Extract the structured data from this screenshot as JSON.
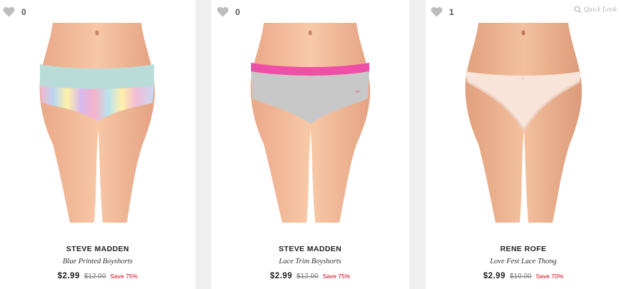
{
  "colors": {
    "background": "#efefef",
    "card": "#ffffff",
    "heart_icon": "#bdbdbd",
    "save_text": "#d0021b",
    "quick_look": "#b8b8b8"
  },
  "products": [
    {
      "likes": "0",
      "brand": "STEVE MADDEN",
      "name": "Blue Printed Boyshorts",
      "price": "$2.99",
      "original_price": "$12.00",
      "savings": "Save 75%",
      "icon": "heart-icon"
    },
    {
      "likes": "0",
      "brand": "STEVE MADDEN",
      "name": "Lace Trim Boyshorts",
      "price": "$2.99",
      "original_price": "$12.00",
      "savings": "Save 75%",
      "icon": "heart-icon"
    },
    {
      "likes": "1",
      "brand": "RENE ROFE",
      "name": "Love Fest Lace Thong",
      "price": "$2.99",
      "original_price": "$10.00",
      "savings": "Save 70%",
      "icon": "heart-icon",
      "quick_look": "Quick Look",
      "quick_look_icon": "magnifier-icon"
    }
  ]
}
